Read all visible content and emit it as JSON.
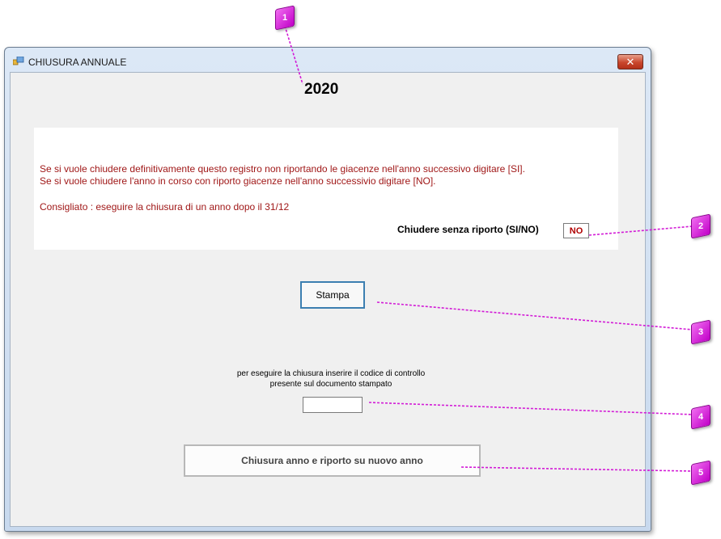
{
  "window": {
    "title": "CHIUSURA ANNUALE",
    "close_glyph": "✕"
  },
  "year": "2020",
  "info": {
    "line1": "Se si vuole chiudere definitivamente questo registro non riportando le giacenze nell'anno successivo digitare [SI].",
    "line2": "Se si vuole chiudere l'anno in corso con riporto giacenze nell'anno successivio digitare [NO].",
    "line3": "Consigliato : eseguire la chiusura di un anno dopo il 31/12",
    "confirm_label": "Chiudere senza riporto (SI/NO)",
    "confirm_value": "NO"
  },
  "print_button": "Stampa",
  "instruction": {
    "line1": "per eseguire la chiusura inserire il codice di controllo",
    "line2": "presente sul documento stampato"
  },
  "code_value": "",
  "close_year_button": "Chiusura anno e riporto su nuovo anno",
  "callouts": [
    "1",
    "2",
    "3",
    "4",
    "5"
  ],
  "colors": {
    "warning_text": "#a01818",
    "callout": "#d21ad6",
    "focus_border": "#3c7fb1"
  }
}
